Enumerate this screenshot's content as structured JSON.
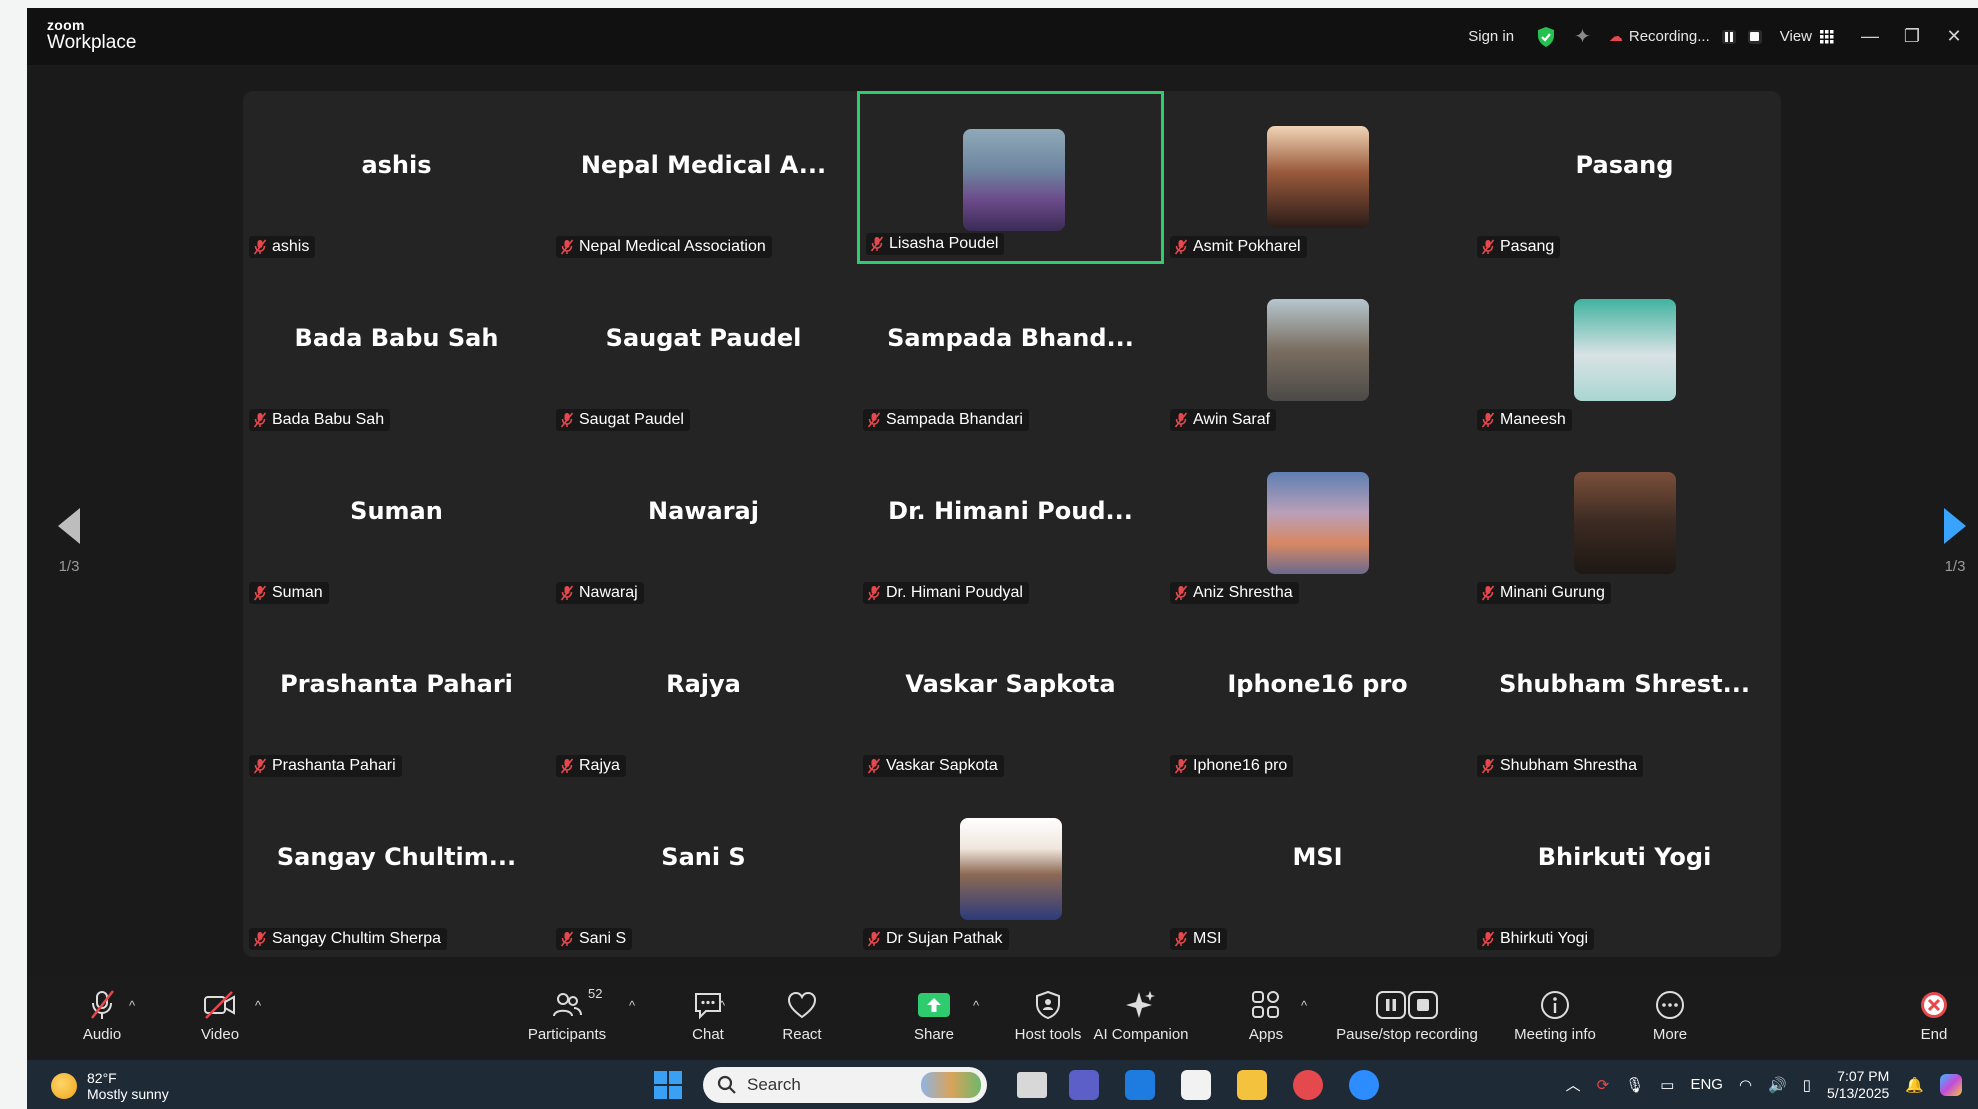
{
  "app": {
    "logo_small": "zoom",
    "logo_big": "Workplace",
    "sign_in": "Sign in",
    "recording": "Recording...",
    "view": "View"
  },
  "tiles": [
    {
      "display": "ashis",
      "name": "ashis",
      "avatar": null
    },
    {
      "display": "Nepal Medical A...",
      "name": "Nepal Medical Association",
      "avatar": null
    },
    {
      "display": "",
      "name": "Lisasha Poudel",
      "avatar": "woman-photo",
      "active": true
    },
    {
      "display": "",
      "name": "Asmit Pokharel",
      "avatar": "man-photo"
    },
    {
      "display": "Pasang",
      "name": "Pasang",
      "avatar": null
    },
    {
      "display": "Bada Babu Sah",
      "name": "Bada Babu Sah",
      "avatar": null
    },
    {
      "display": "Saugat Paudel",
      "name": "Saugat Paudel",
      "avatar": null
    },
    {
      "display": "Sampada Bhand...",
      "name": "Sampada Bhandari",
      "avatar": null
    },
    {
      "display": "",
      "name": "Awin Saraf",
      "avatar": "temple-photo"
    },
    {
      "display": "",
      "name": "Maneesh",
      "avatar": "surgeon-photo"
    },
    {
      "display": "Suman",
      "name": "Suman",
      "avatar": null
    },
    {
      "display": "Nawaraj",
      "name": "Nawaraj",
      "avatar": null
    },
    {
      "display": "Dr. Himani Poud...",
      "name": "Dr. Himani Poudyal",
      "avatar": null
    },
    {
      "display": "",
      "name": "Aniz Shrestha",
      "avatar": "mountain-photo"
    },
    {
      "display": "",
      "name": "Minani Gurung",
      "avatar": "woman-photo-2"
    },
    {
      "display": "Prashanta Pahari",
      "name": "Prashanta Pahari",
      "avatar": null
    },
    {
      "display": "Rajya",
      "name": "Rajya",
      "avatar": null
    },
    {
      "display": "Vaskar Sapkota",
      "name": "Vaskar Sapkota",
      "avatar": null
    },
    {
      "display": "Iphone16 pro",
      "name": "Iphone16 pro",
      "avatar": null
    },
    {
      "display": "Shubham Shrest...",
      "name": "Shubham Shrestha",
      "avatar": null
    },
    {
      "display": "Sangay Chultim...",
      "name": "Sangay Chultim Sherpa",
      "avatar": null
    },
    {
      "display": "Sani S",
      "name": "Sani S",
      "avatar": null
    },
    {
      "display": "",
      "name": "Dr Sujan Pathak",
      "avatar": "man-photo-2"
    },
    {
      "display": "MSI",
      "name": "MSI",
      "avatar": null
    },
    {
      "display": "Bhirkuti Yogi",
      "name": "Bhirkuti Yogi",
      "avatar": null
    }
  ],
  "pager": {
    "left": "1/3",
    "right": "1/3"
  },
  "toolbar": {
    "audio": "Audio",
    "video": "Video",
    "participants": "Participants",
    "participant_count": "52",
    "chat": "Chat",
    "react": "React",
    "share": "Share",
    "host_tools": "Host tools",
    "ai_companion": "AI Companion",
    "apps": "Apps",
    "pause_stop": "Pause/stop recording",
    "meeting_info": "Meeting info",
    "more": "More",
    "end": "End"
  },
  "taskbar": {
    "temp": "82°F",
    "weather": "Mostly sunny",
    "search_placeholder": "Search",
    "lang": "ENG",
    "time": "7:07 PM",
    "date": "5/13/2025"
  },
  "colors": {
    "active_border": "#2fcc6f",
    "mute_red": "#e5484d",
    "share_green": "#2fcc6f"
  }
}
